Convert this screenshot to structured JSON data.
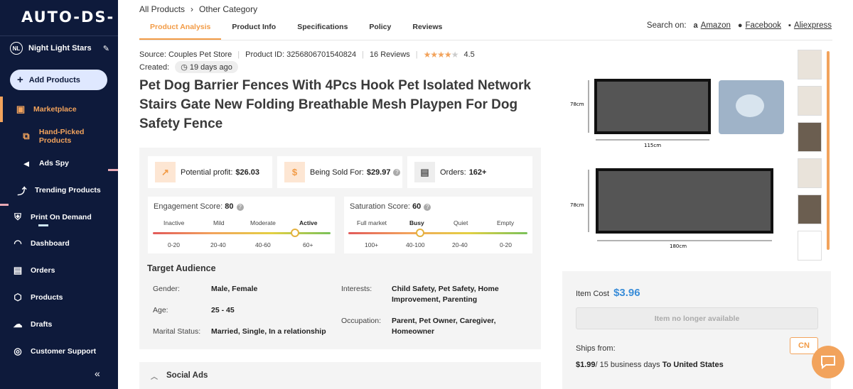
{
  "sidebar": {
    "logo": "AUTO-DS-",
    "store_initials": "NL",
    "store_name": "Night Light Stars",
    "add_products": "Add Products",
    "items": [
      {
        "label": "Marketplace",
        "icon": "store-icon"
      },
      {
        "label": "Hand-Picked Products",
        "icon": "star-box-icon"
      },
      {
        "label": "Ads Spy",
        "icon": "megaphone-icon"
      },
      {
        "label": "Trending Products",
        "icon": "trend-icon"
      },
      {
        "label": "Print On Demand",
        "icon": "shirt-icon"
      },
      {
        "label": "Dashboard",
        "icon": "gauge-icon"
      },
      {
        "label": "Orders",
        "icon": "clipboard-icon"
      },
      {
        "label": "Products",
        "icon": "box-icon"
      },
      {
        "label": "Drafts",
        "icon": "cloud-upload-icon"
      },
      {
        "label": "Customer Support",
        "icon": "headset-icon"
      }
    ],
    "collapse": "«"
  },
  "breadcrumb": {
    "first": "All Products",
    "second": "Other Category"
  },
  "tabs": [
    "Product Analysis",
    "Product Info",
    "Specifications",
    "Policy",
    "Reviews"
  ],
  "search_on": {
    "label": "Search on:",
    "links": [
      "Amazon",
      "Facebook",
      "Aliexpress"
    ]
  },
  "meta": {
    "source": "Source: Couples Pet Store",
    "product_id": "Product ID: 3256806701540824",
    "reviews": "16 Reviews",
    "rating": "4.5",
    "created_label": "Created:",
    "created_value": "19 days ago"
  },
  "title": "Pet Dog Barrier Fences With 4Pcs Hook Pet Isolated Network Stairs Gate New Folding Breathable Mesh Playpen For Dog Safety Fence",
  "stats": {
    "profit_label": "Potential profit:",
    "profit_value": "$26.03",
    "sold_label": "Being Sold For:",
    "sold_value": "$29.97",
    "orders_label": "Orders:",
    "orders_value": "162+"
  },
  "engagement": {
    "label": "Engagement Score:",
    "value": "80",
    "level": 0.8,
    "scale": [
      "Inactive",
      "Mild",
      "Moderate",
      "Active"
    ],
    "ranges": [
      "0-20",
      "20-40",
      "40-60",
      "60+"
    ]
  },
  "saturation": {
    "label": "Saturation Score:",
    "value": "60",
    "level": 0.4,
    "scale": [
      "Full market",
      "Busy",
      "Quiet",
      "Empty"
    ],
    "ranges": [
      "100+",
      "40-100",
      "20-40",
      "0-20"
    ]
  },
  "audience": {
    "title": "Target Audience",
    "gender_label": "Gender:",
    "gender": "Male, Female",
    "age_label": "Age:",
    "age": "25 - 45",
    "marital_label": "Marital Status:",
    "marital": "Married, Single, In a relationship",
    "interests_label": "Interests:",
    "interests": "Child Safety, Pet Safety, Home Improvement, Parenting",
    "occupation_label": "Occupation:",
    "occupation": "Parent, Pet Owner, Caregiver, Homeowner"
  },
  "social_ads": "Social Ads",
  "image": {
    "dim1": "78cm",
    "dim2": "115cm",
    "dim3": "78cm",
    "dim4": "180cm"
  },
  "buy": {
    "item_cost_label": "Item Cost",
    "item_cost": "$3.96",
    "unavailable": "Item no longer available",
    "ships_from": "Ships from:",
    "origin": "CN",
    "ship_price": "$1.99",
    "ship_days": "/ 15 business days",
    "ship_to": "To United States"
  },
  "colors": {
    "accent": "#f29b46",
    "sidebar": "#0e1a3b",
    "price": "#3a8dd8"
  }
}
